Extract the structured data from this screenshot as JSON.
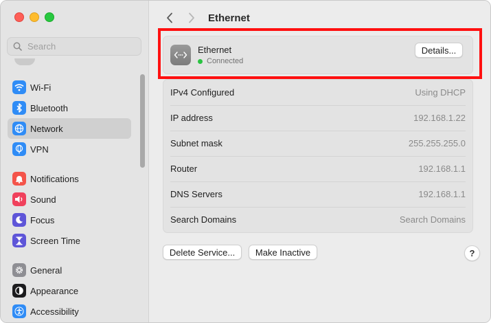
{
  "sidebar": {
    "search_placeholder": "Search",
    "items": [
      {
        "label": "Wi-Fi",
        "icon": "wifi-icon",
        "color": "#2f8cf6"
      },
      {
        "label": "Bluetooth",
        "icon": "bluetooth-icon",
        "color": "#2f8cf6"
      },
      {
        "label": "Network",
        "icon": "globe-icon",
        "color": "#2f8cf6",
        "selected": true
      },
      {
        "label": "VPN",
        "icon": "vpn-globe-icon",
        "color": "#2f8cf6"
      },
      {
        "label": "Notifications",
        "icon": "bell-icon",
        "color": "#f4544a"
      },
      {
        "label": "Sound",
        "icon": "speaker-icon",
        "color": "#f0415c"
      },
      {
        "label": "Focus",
        "icon": "moon-icon",
        "color": "#5e55d8"
      },
      {
        "label": "Screen Time",
        "icon": "hourglass-icon",
        "color": "#5e55d8"
      },
      {
        "label": "General",
        "icon": "gear-icon",
        "color": "#8e8e93"
      },
      {
        "label": "Appearance",
        "icon": "appearance-icon",
        "color": "#1c1c1e"
      },
      {
        "label": "Accessibility",
        "icon": "accessibility-icon",
        "color": "#2f8cf6"
      }
    ]
  },
  "header": {
    "title": "Ethernet"
  },
  "ethernet": {
    "name": "Ethernet",
    "status": "Connected",
    "status_color": "#2ac341",
    "details_label": "Details..."
  },
  "info_rows": [
    {
      "label": "IPv4 Configured",
      "value": "Using DHCP"
    },
    {
      "label": "IP address",
      "value": "192.168.1.22"
    },
    {
      "label": "Subnet mask",
      "value": "255.255.255.0"
    },
    {
      "label": "Router",
      "value": "192.168.1.1"
    },
    {
      "label": "DNS Servers",
      "value": "192.168.1.1"
    },
    {
      "label": "Search Domains",
      "value": "Search Domains"
    }
  ],
  "footer": {
    "delete_label": "Delete Service...",
    "inactive_label": "Make Inactive",
    "help_label": "?"
  },
  "highlight_color": "#ff1010"
}
